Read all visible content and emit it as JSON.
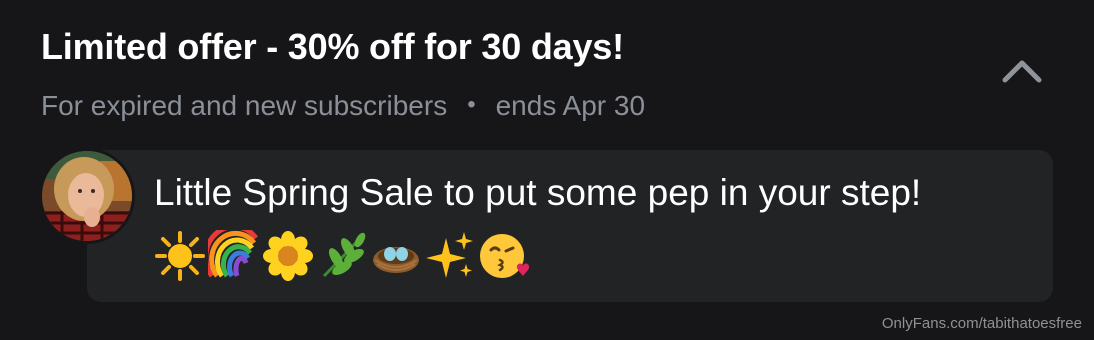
{
  "offer": {
    "title": "Limited offer - 30% off for 30 days!",
    "audience": "For expired and new subscribers",
    "separator": "•",
    "ends": "ends Apr 30"
  },
  "message": {
    "text": "Little Spring Sale to put some pep in your step!",
    "emojis": [
      "☀️",
      "🌈",
      "🌼",
      "🌿",
      "🪺",
      "✨",
      "😘"
    ]
  },
  "watermark": "OnlyFans.com/tabithatoesfree",
  "icons": {
    "collapse": "chevron-up-icon",
    "avatar": "avatar"
  },
  "colors": {
    "background": "#161618",
    "bubble": "#212325",
    "title": "#ffffff",
    "meta": "#8a8f98",
    "chevron": "#8f949c"
  }
}
